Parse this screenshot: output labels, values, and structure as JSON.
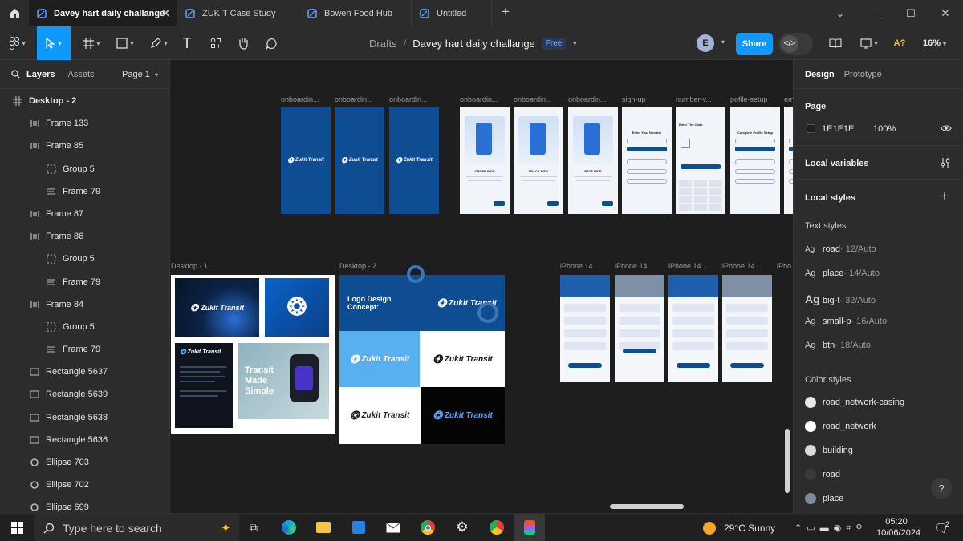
{
  "tabs": [
    {
      "label": "Davey hart daily challange",
      "active": true
    },
    {
      "label": "ZUKIT Case Study",
      "active": false
    },
    {
      "label": "Bowen Food Hub",
      "active": false
    },
    {
      "label": "Untitled",
      "active": false
    }
  ],
  "toolbar": {
    "breadcrumb_root": "Drafts",
    "breadcrumb_sep": "/",
    "file_name": "Davey hart daily challange",
    "plan_badge": "Free",
    "avatar_initial": "E",
    "share_label": "Share",
    "zoom": "16%"
  },
  "left_panel": {
    "tab_layers": "Layers",
    "tab_assets": "Assets",
    "page_selector": "Page 1",
    "layers": [
      {
        "label": "Desktop - 2",
        "type": "frame-grid",
        "indent": 0,
        "bold": true
      },
      {
        "label": "Frame 133",
        "type": "autolayout",
        "indent": 1
      },
      {
        "label": "Frame 85",
        "type": "autolayout",
        "indent": 1
      },
      {
        "label": "Group 5",
        "type": "group",
        "indent": 2
      },
      {
        "label": "Frame 79",
        "type": "frame-lines",
        "indent": 2
      },
      {
        "label": "Frame 87",
        "type": "autolayout",
        "indent": 1
      },
      {
        "label": "Frame 86",
        "type": "autolayout",
        "indent": 1
      },
      {
        "label": "Group 5",
        "type": "group",
        "indent": 2
      },
      {
        "label": "Frame 79",
        "type": "frame-lines",
        "indent": 2
      },
      {
        "label": "Frame 84",
        "type": "autolayout",
        "indent": 1
      },
      {
        "label": "Group 5",
        "type": "group",
        "indent": 2
      },
      {
        "label": "Frame 79",
        "type": "frame-lines",
        "indent": 2
      },
      {
        "label": "Rectangle 5637",
        "type": "rectangle",
        "indent": 1
      },
      {
        "label": "Rectangle 5639",
        "type": "rectangle",
        "indent": 1
      },
      {
        "label": "Rectangle 5638",
        "type": "rectangle",
        "indent": 1
      },
      {
        "label": "Rectangle 5636",
        "type": "rectangle",
        "indent": 1
      },
      {
        "label": "Ellipse 703",
        "type": "ellipse",
        "indent": 1
      },
      {
        "label": "Ellipse 702",
        "type": "ellipse",
        "indent": 1
      },
      {
        "label": "Ellipse 699",
        "type": "ellipse",
        "indent": 1
      }
    ]
  },
  "right_panel": {
    "tab_design": "Design",
    "tab_prototype": "Prototype",
    "page_section": "Page",
    "page_color": "1E1E1E",
    "page_opacity": "100%",
    "local_variables": "Local variables",
    "local_styles": "Local styles",
    "text_styles_title": "Text styles",
    "text_styles": [
      {
        "ag": "Ag",
        "name": "road",
        "meta": " · 12/Auto"
      },
      {
        "ag": "Ag",
        "name": "place",
        "meta": " · 14/Auto"
      },
      {
        "ag": "Ag",
        "name": "big-t",
        "meta": " · 32/Auto"
      },
      {
        "ag": "Ag",
        "name": "small-p",
        "meta": " · 16/Auto"
      },
      {
        "ag": "Ag",
        "name": "btn",
        "meta": " · 18/Auto"
      }
    ],
    "color_styles_title": "Color styles",
    "color_styles": [
      {
        "name": "road_network-casing",
        "color": "#e9e9e9"
      },
      {
        "name": "road_network",
        "color": "#ffffff"
      },
      {
        "name": "building",
        "color": "#d9d9d9"
      },
      {
        "name": "road",
        "color": "#3a3a3a"
      },
      {
        "name": "place",
        "color": "#7d8a99"
      }
    ],
    "help": "?"
  },
  "canvas": {
    "top_frames": [
      {
        "label": "onboardin...",
        "kind": "splash"
      },
      {
        "label": "onboardin...",
        "kind": "splash"
      },
      {
        "label": "onboardin...",
        "kind": "splash"
      },
      {
        "label": "onboardin...",
        "kind": "onboard"
      },
      {
        "label": "onboardin...",
        "kind": "onboard"
      },
      {
        "label": "onboardin...",
        "kind": "onboard"
      },
      {
        "label": "sign-up",
        "kind": "form"
      },
      {
        "label": "number-v...",
        "kind": "keypad"
      },
      {
        "label": "pofile-setup",
        "kind": "form"
      },
      {
        "label": "em",
        "kind": "form"
      }
    ],
    "iphone_frames": [
      {
        "label": "iPhone 14 ..."
      },
      {
        "label": "iPhone 14 ..."
      },
      {
        "label": "iPhone 14 ..."
      },
      {
        "label": "iPhone 14 ..."
      },
      {
        "label": "iPho"
      }
    ],
    "brand_name": "Zukit Transit",
    "desktop1_label": "Desktop - 1",
    "desktop2_label": "Desktop - 2",
    "logo_concept_title": "Logo Design Concept:",
    "tagline": "Transit Made Simple",
    "onboard_titles": [
      "ORDER RIDE",
      "TRACK RIDE",
      "RATE RIDE"
    ],
    "signup_title": "Enter Your Number",
    "code_title": "Enter The Code",
    "profile_title": "Complete Profile Setup",
    "brand_blue": "#0e4d92"
  },
  "taskbar": {
    "search_placeholder": "Type here to search",
    "weather": "29°C  Sunny",
    "time": "05:20",
    "date": "10/06/2024",
    "notifications": "2"
  }
}
